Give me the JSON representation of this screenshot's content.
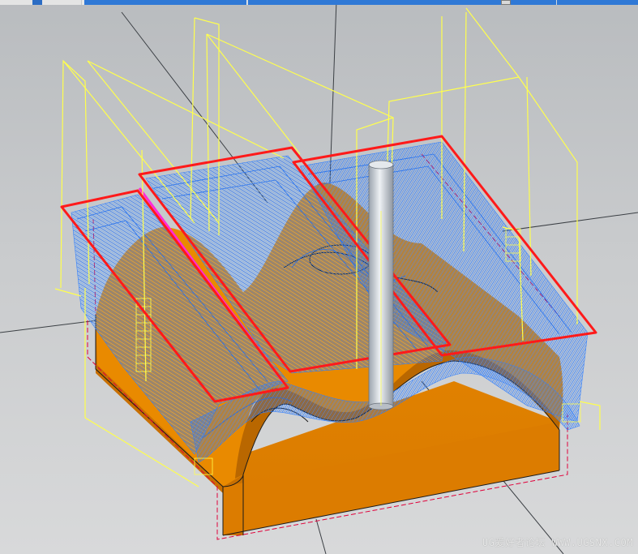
{
  "viewport": {
    "background_top": "#b9bcbf",
    "background_bottom": "#d8d9da",
    "part_color": "#e07f00",
    "part_shade_color": "#c36d00",
    "toolpath_color": "#2f7fff",
    "engage_color": "#ffff4d",
    "boundary_color": "#ff1a1a",
    "boundary_dash_color": "#e0003a",
    "highlight_edge_color": "#ff2bd6",
    "tool_color": "#d6dbe2"
  },
  "toolbar": {
    "accent_color": "#2f78d6",
    "dropdown_icon": "chevron-down-icon"
  },
  "watermark": {
    "text": "UG爱好者论坛 WWW.UGSNX.COM"
  }
}
